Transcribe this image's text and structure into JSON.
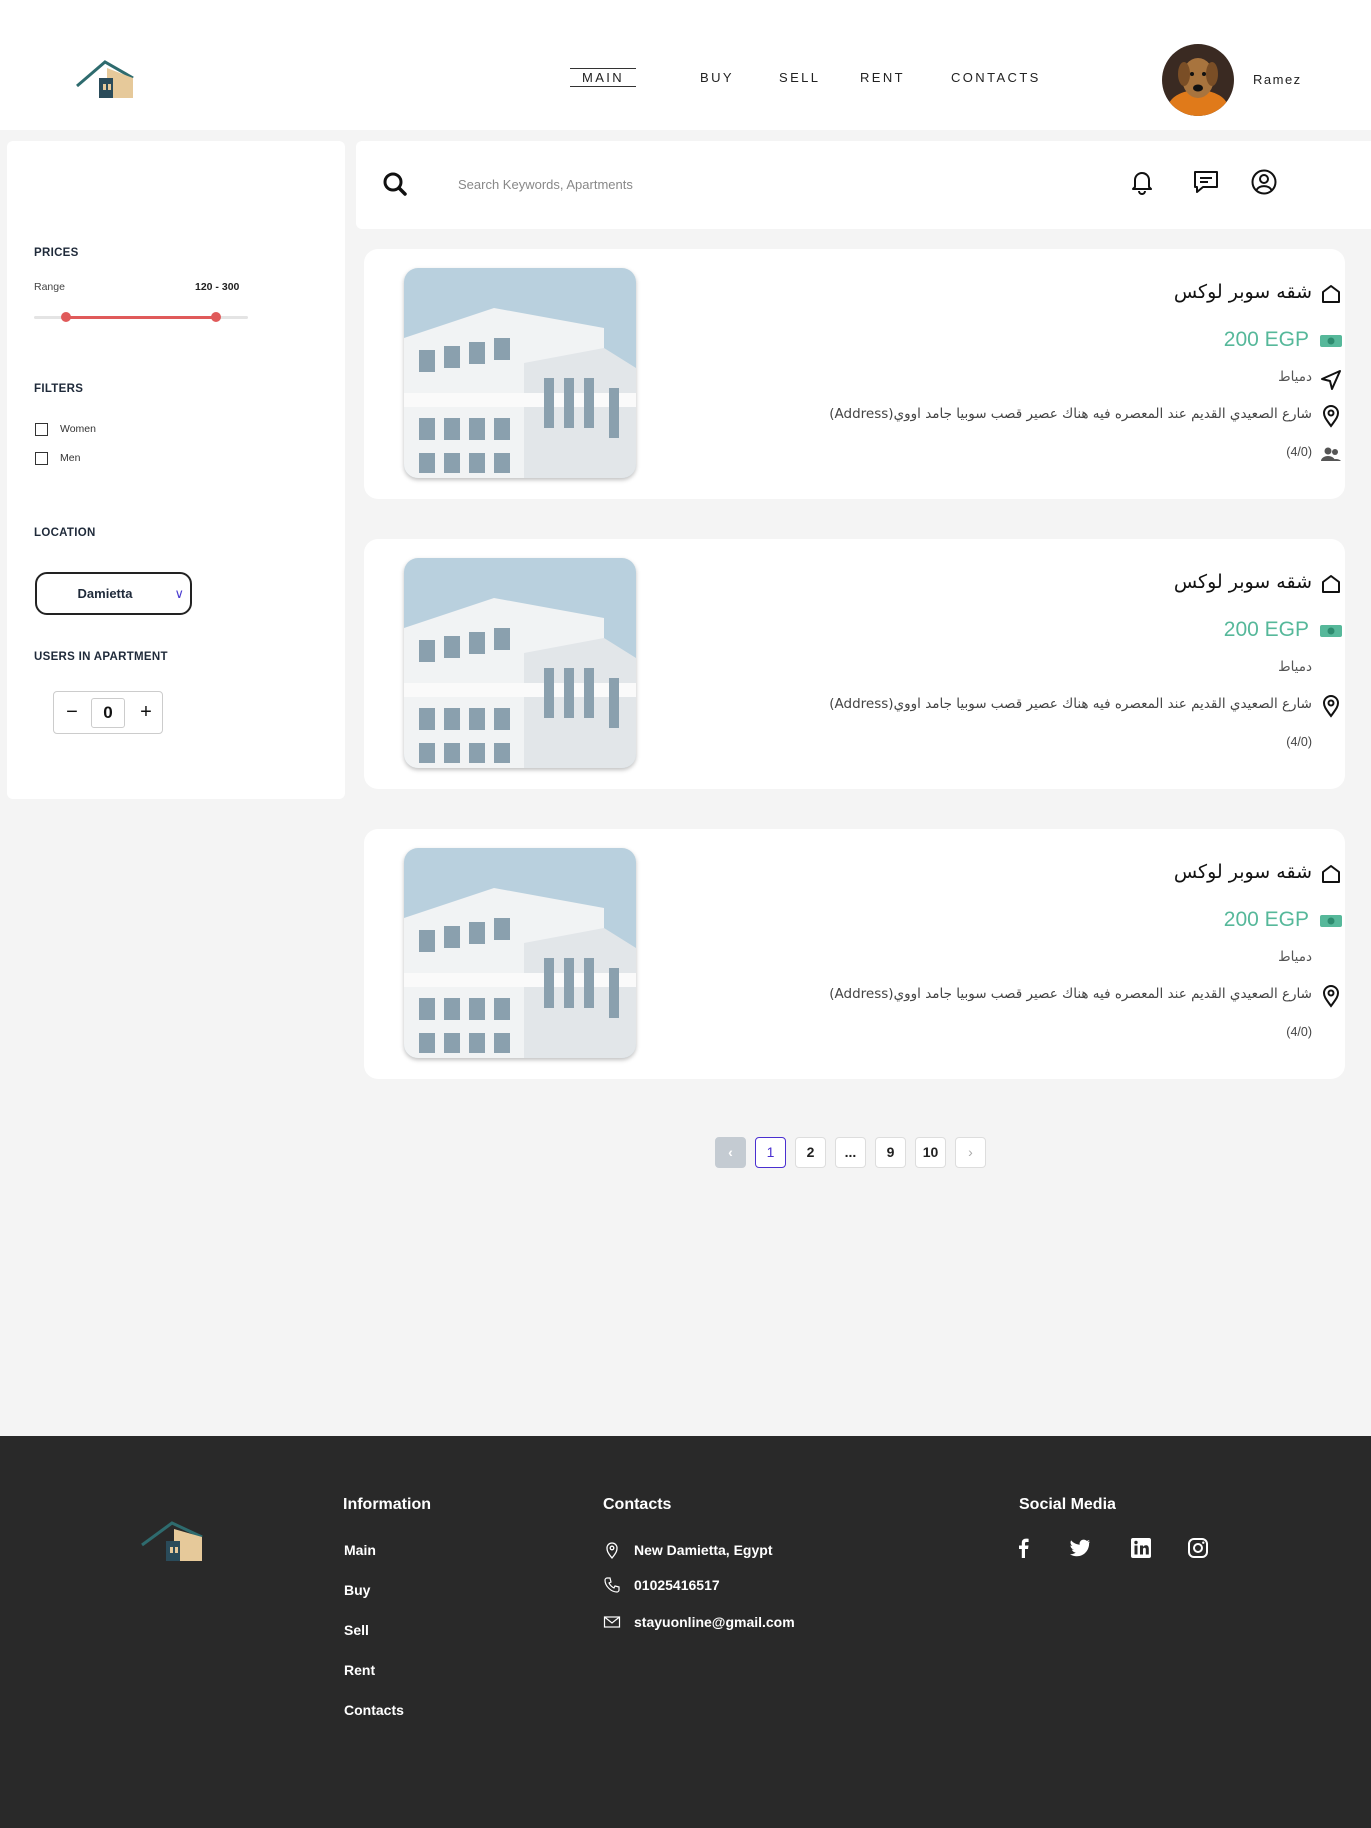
{
  "header": {
    "nav": [
      "MAIN",
      "BUY",
      "SELL",
      "RENT",
      "CONTACTS"
    ],
    "active_nav": "MAIN",
    "username": "Ramez"
  },
  "sidebar": {
    "prices_title": "PRICES",
    "range_label": "Range",
    "range_value": "120 - 300",
    "range_min_fraction": 0.15,
    "range_max_fraction": 0.85,
    "filters_title": "FILTERS",
    "filters": [
      "Women",
      "Men"
    ],
    "location_title": "LOCATION",
    "location_value": "Damietta",
    "users_title": "USERS IN APARTMENT",
    "users_count": "0",
    "minus": "−",
    "plus": "+"
  },
  "search": {
    "placeholder": "Search Keywords, Apartments"
  },
  "listings": [
    {
      "title": "شقه سوبر لوكس",
      "price": "200 EGP",
      "city": "دمياط",
      "address": "شارع الصعيدي القديم عند المعصره فيه هناك عصير قصب سوبيا جامد اووي(Address)",
      "users": "(4/0)"
    },
    {
      "title": "شقه سوبر لوكس",
      "price": "200 EGP",
      "city": "دمياط",
      "address": "شارع الصعيدي القديم عند المعصره فيه هناك عصير قصب سوبيا جامد اووي(Address)",
      "users": "(4/0)"
    },
    {
      "title": "شقه سوبر لوكس",
      "price": "200 EGP",
      "city": "دمياط",
      "address": "شارع الصعيدي القديم عند المعصره فيه هناك عصير قصب سوبيا جامد اووي(Address)",
      "users": "(4/0)"
    }
  ],
  "pagination": {
    "prev": "‹",
    "pages": [
      "1",
      "2",
      "...",
      "9",
      "10"
    ],
    "next": "›",
    "current": "1"
  },
  "footer": {
    "information_title": "Information",
    "links": [
      "Main",
      "Buy",
      "Sell",
      "Rent",
      "Contacts"
    ],
    "contacts_title": "Contacts",
    "address": "New Damietta, Egypt",
    "phone": "01025416517",
    "email": "stayuonline@gmail.com",
    "social_title": "Social Media",
    "social": [
      "facebook-icon",
      "twitter-icon",
      "linkedin-icon",
      "instagram-icon"
    ]
  },
  "colors": {
    "accent_price": "#56b89a",
    "range_red": "#e05a5a",
    "footer_bg": "#292929",
    "pagination_active": "#4a2fd0"
  }
}
